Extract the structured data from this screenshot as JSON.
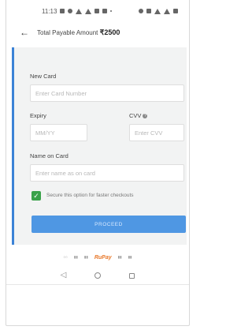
{
  "status_bar": {
    "time": "11:13"
  },
  "header": {
    "label": "Total Payable Amount",
    "amount": "₹2500"
  },
  "form": {
    "card_label": "New Card",
    "card_placeholder": "Enter Card Number",
    "expiry_label": "Expiry",
    "expiry_placeholder": "MM/YY",
    "cvv_label": "CVV",
    "cvv_placeholder": "Enter CVV",
    "name_label": "Name on Card",
    "name_placeholder": "Enter name as on card",
    "save_option_text": "Secure this option for faster checkouts",
    "save_option_checked": true,
    "proceed_label": "PROCEED"
  },
  "payment_logos": {
    "rupay": "RuPay"
  },
  "colors": {
    "accent": "#3b82d6",
    "button": "#4f97e3",
    "check": "#3aa24a",
    "panel": "#f2f3f3"
  }
}
